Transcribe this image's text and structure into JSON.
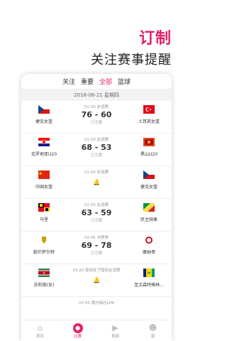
{
  "promo": {
    "title": "订制",
    "subtitle": "关注赛事提醒"
  },
  "tabs": [
    "关注",
    "重要",
    "全部",
    "篮球"
  ],
  "active_tab": 2,
  "date": "2018-06-21 星期四",
  "matches": [
    {
      "time": "01:00",
      "league": "友谊赛",
      "home": "捷克女篮",
      "away": "土耳其女篮",
      "score": "76 - 60",
      "status": "已完赛"
    },
    {
      "time": "01:00",
      "league": "友谊赛",
      "home": "克罗地亚U20",
      "away": "黑山U20",
      "score": "68 - 53",
      "status": "已完赛"
    },
    {
      "time": "01:00",
      "league": "友谊赛",
      "home": "中国女篮",
      "away": "捷克女篮",
      "score": "",
      "status": ""
    },
    {
      "time": "02:00",
      "league": "友谊赛",
      "home": "马里",
      "away": "民主刚果",
      "score": "63 - 59",
      "status": "已完赛"
    },
    {
      "time": "02:45",
      "league": "决赛季",
      "home": "勒芒萨尔特",
      "away": "摩纳哥",
      "score": "69 - 78",
      "status": "已完赛"
    },
    {
      "time": "03:20",
      "league": "篮球女子国际友谊赛",
      "home": "苏利南(女)",
      "away": "圣文森特格林...",
      "score": "",
      "status": ""
    },
    {
      "time": "07:00",
      "league": "委内瑞拉LPB",
      "home": "",
      "away": "",
      "score": "",
      "status": ""
    }
  ],
  "nav": [
    "首页",
    "比赛",
    "视频",
    "我"
  ],
  "active_nav": 1,
  "colors": {
    "accent": "#e6206a"
  }
}
